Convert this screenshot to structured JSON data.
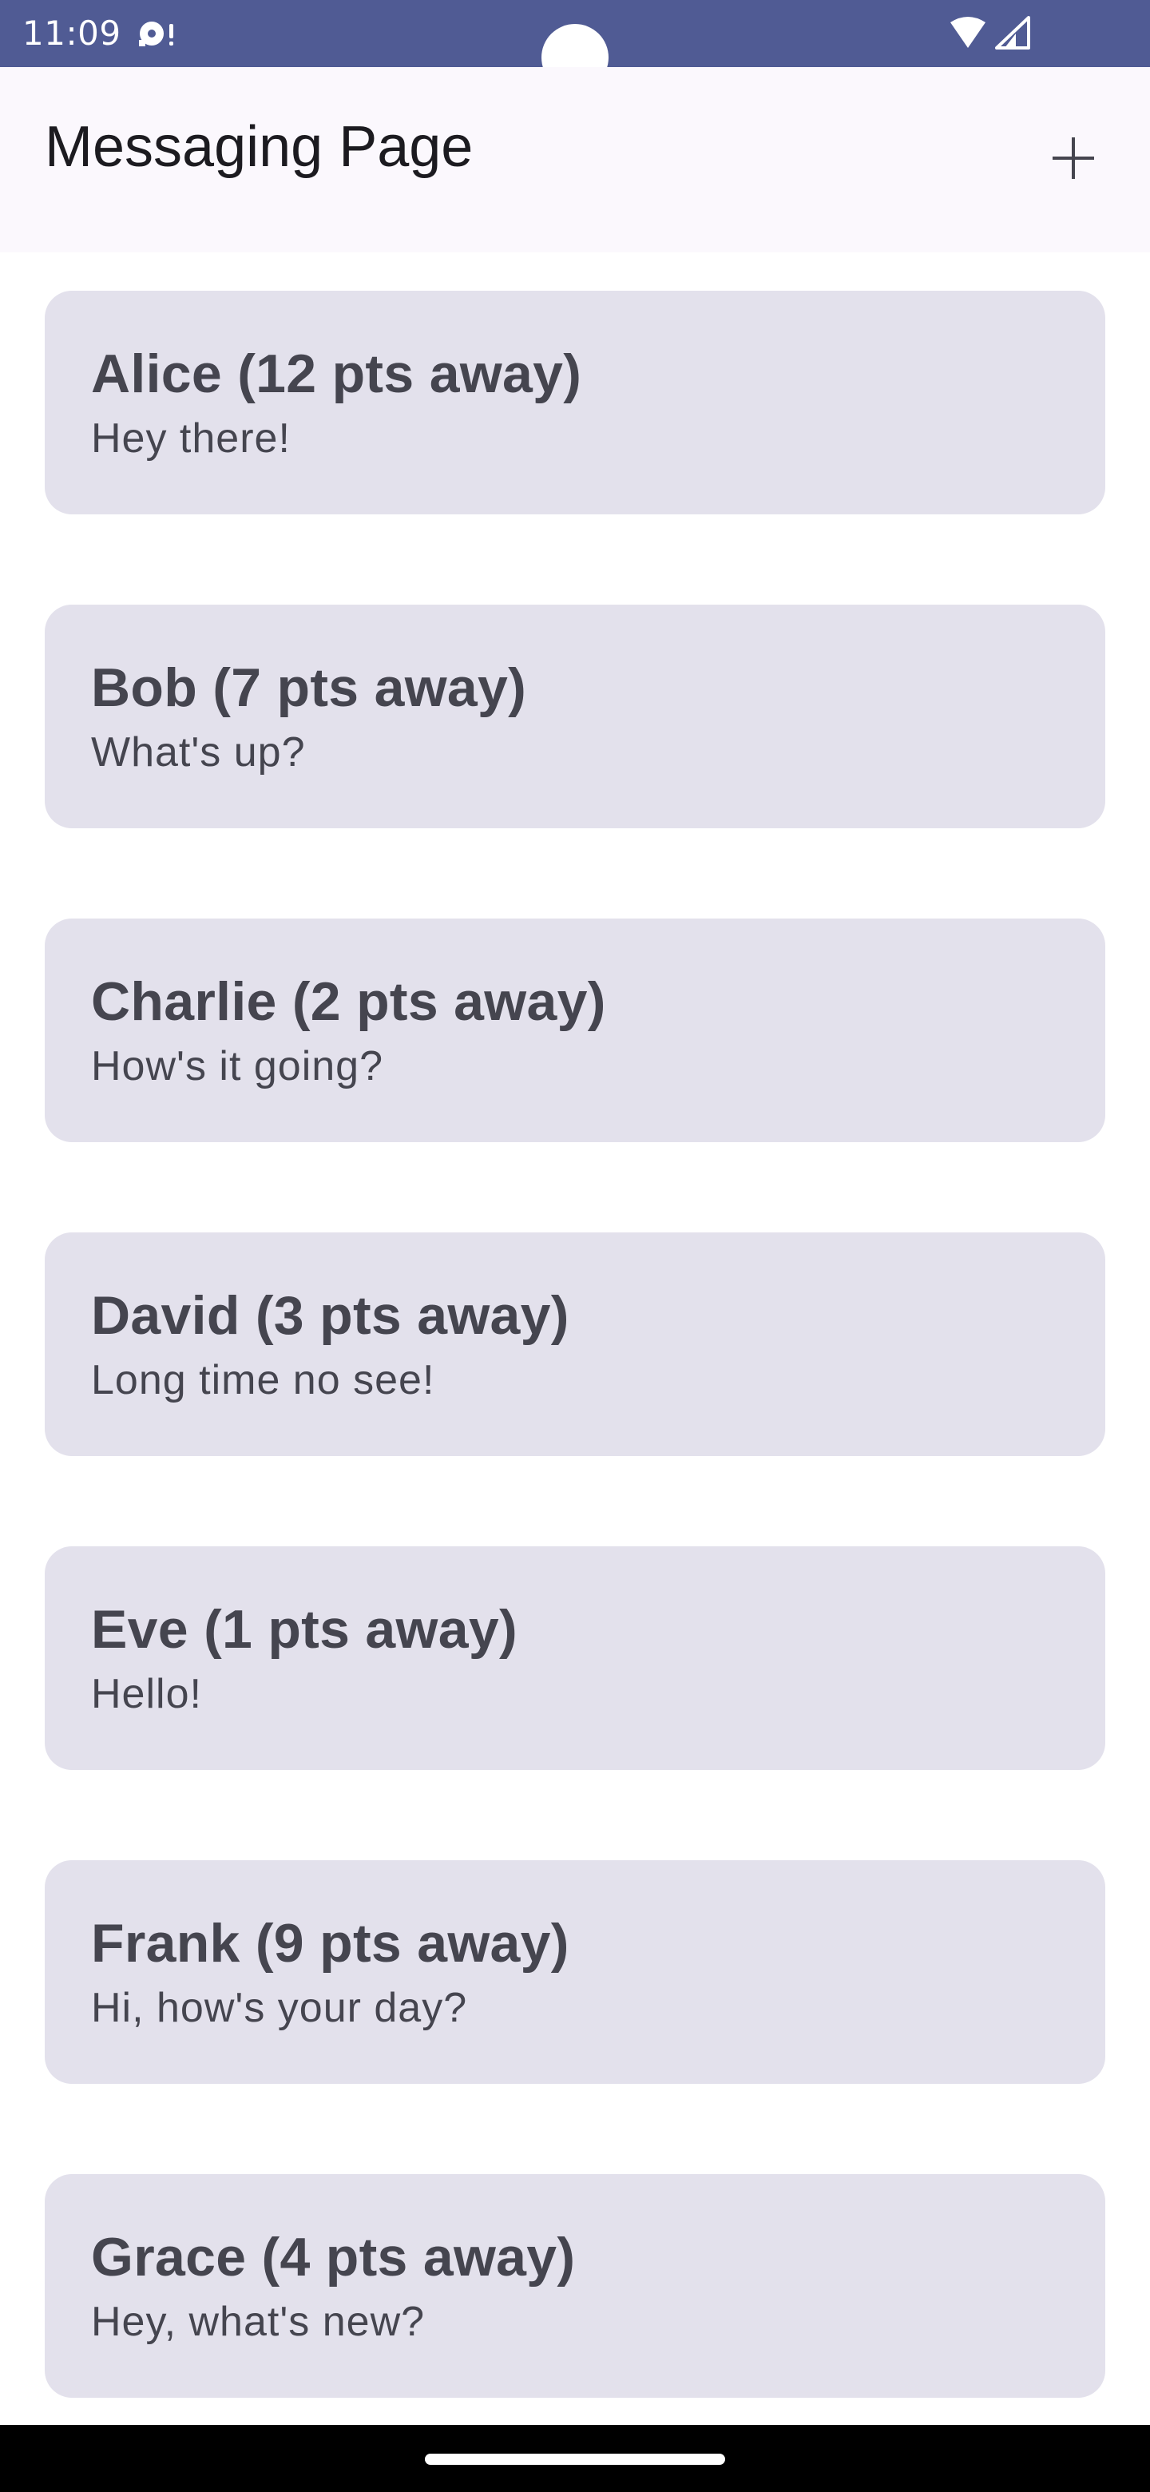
{
  "status_bar": {
    "time": "11:09",
    "background_color": "#505b94",
    "icons": [
      "notification-icon",
      "wifi-icon",
      "signal-icon"
    ]
  },
  "header": {
    "title": "Messaging Page",
    "add_icon": "plus-icon"
  },
  "conversations": [
    {
      "name": "Alice (12 pts away)",
      "message": "Hey there!"
    },
    {
      "name": "Bob (7 pts away)",
      "message": "What's up?"
    },
    {
      "name": "Charlie (2 pts away)",
      "message": "How's it going?"
    },
    {
      "name": "David (3 pts away)",
      "message": "Long time no see!"
    },
    {
      "name": "Eve (1 pts away)",
      "message": "Hello!"
    },
    {
      "name": "Frank (9 pts away)",
      "message": "Hi, how's your day?"
    },
    {
      "name": "Grace (4 pts away)",
      "message": "Hey, what's new?"
    }
  ],
  "colors": {
    "card_background": "#e3e1ec",
    "card_text": "#45454f",
    "app_bar_background": "#fbf8fd"
  }
}
